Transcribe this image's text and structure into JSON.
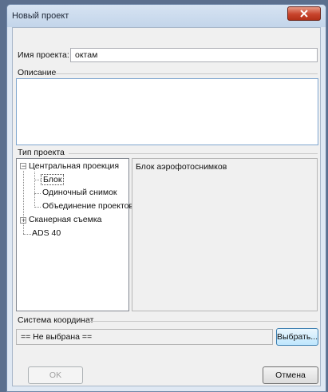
{
  "window": {
    "title": "Новый проект"
  },
  "form": {
    "project_name_label": "Имя проекта:",
    "project_name_value": "октам",
    "description_label": "Описание",
    "description_value": "",
    "project_type_label": "Тип проекта",
    "tree": [
      {
        "label": "Центральная проекция",
        "expander": "−"
      },
      {
        "label": "Блок",
        "selected": true
      },
      {
        "label": "Одиночный снимок"
      },
      {
        "label": "Объединение проектов"
      },
      {
        "label": "Сканерная съемка",
        "expander": "+"
      },
      {
        "label": "ADS 40"
      }
    ],
    "type_description": "Блок аэрофотоснимков",
    "coord_system_label": "Система координат",
    "coord_system_value": "== Не выбрана ==",
    "choose_button": "Выбрать...",
    "ok_button": "OK",
    "cancel_button": "Отмена"
  }
}
